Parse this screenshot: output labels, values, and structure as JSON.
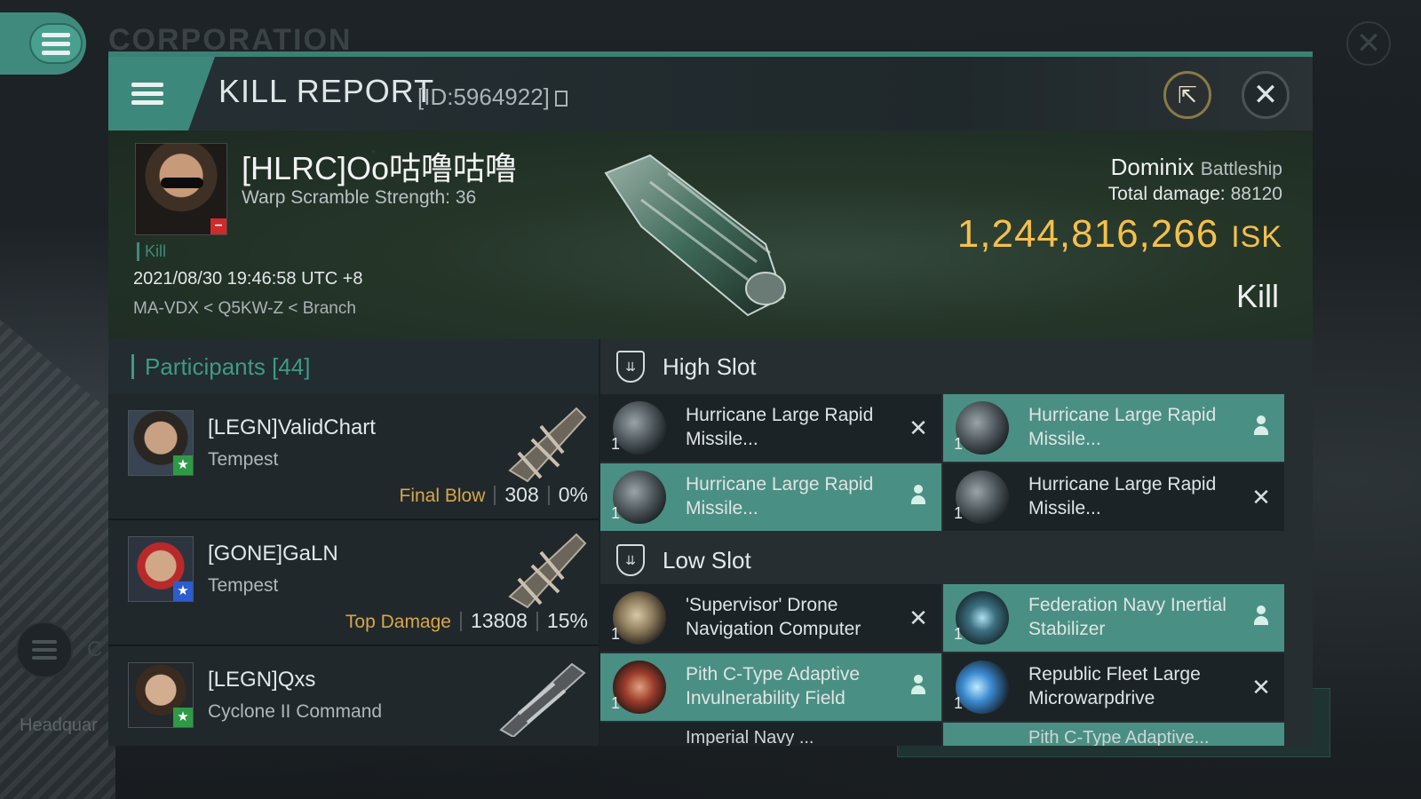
{
  "background": {
    "corp_title": "CORPORATION",
    "headquarters_text": "Headquar",
    "side_letter": "C"
  },
  "header": {
    "title": "KILL REPORT",
    "report_id": "[ID:5964922]",
    "share_icon": "share-icon",
    "close_icon": "close-icon"
  },
  "summary": {
    "victim_name": "[HLRC]Oo咕噜咕噜",
    "warp_scramble": "Warp Scramble Strength: 36",
    "kill_tag": "Kill",
    "datetime": "2021/08/30 19:46:58 UTC +8",
    "location": "MA-VDX < Q5KW-Z < Branch",
    "ship_name": "Dominix",
    "ship_class": "Battleship",
    "total_damage_label": "Total damage:",
    "total_damage": "88120",
    "isk_value": "1,244,816,266",
    "isk_unit": "ISK",
    "result": "Kill"
  },
  "participants": {
    "title": "Participants [44]",
    "rows": [
      {
        "name": "[LEGN]ValidChart",
        "ship": "Tempest",
        "tag": "Final Blow",
        "damage": "308",
        "percent": "0%",
        "badge": "green"
      },
      {
        "name": "[GONE]GaLN",
        "ship": "Tempest",
        "tag": "Top Damage",
        "damage": "13808",
        "percent": "15%",
        "badge": "blue"
      },
      {
        "name": "[LEGN]Qxs",
        "ship": "Cyclone II Command",
        "tag": "",
        "damage": "",
        "percent": "",
        "badge": "green"
      }
    ]
  },
  "slots": {
    "high_title": "High Slot",
    "low_title": "Low Slot",
    "high": [
      {
        "name": "Hurricane Large Rapid Missile...",
        "qty": "1",
        "status": "destroyed"
      },
      {
        "name": "Hurricane Large Rapid Missile...",
        "qty": "1",
        "status": "dropped"
      },
      {
        "name": "Hurricane Large Rapid Missile...",
        "qty": "1",
        "status": "dropped"
      },
      {
        "name": "Hurricane Large Rapid Missile...",
        "qty": "1",
        "status": "destroyed"
      }
    ],
    "low": [
      {
        "name": "'Supervisor' Drone Navigation Computer",
        "qty": "1",
        "status": "destroyed"
      },
      {
        "name": "Federation Navy Inertial Stabilizer",
        "qty": "1",
        "status": "dropped"
      },
      {
        "name": "Pith C-Type Adaptive Invulnerability Field",
        "qty": "1",
        "status": "dropped"
      },
      {
        "name": "Republic Fleet Large Microwarpdrive",
        "qty": "1",
        "status": "destroyed"
      }
    ],
    "partial": [
      {
        "name": "Imperial Navy ..."
      },
      {
        "name": "Pith C-Type Adaptive..."
      }
    ]
  },
  "colors": {
    "accent": "#3e9a88",
    "isk": "#f4c04c",
    "dropped_row": "#4a8f83",
    "tag": "#d9a64a"
  }
}
